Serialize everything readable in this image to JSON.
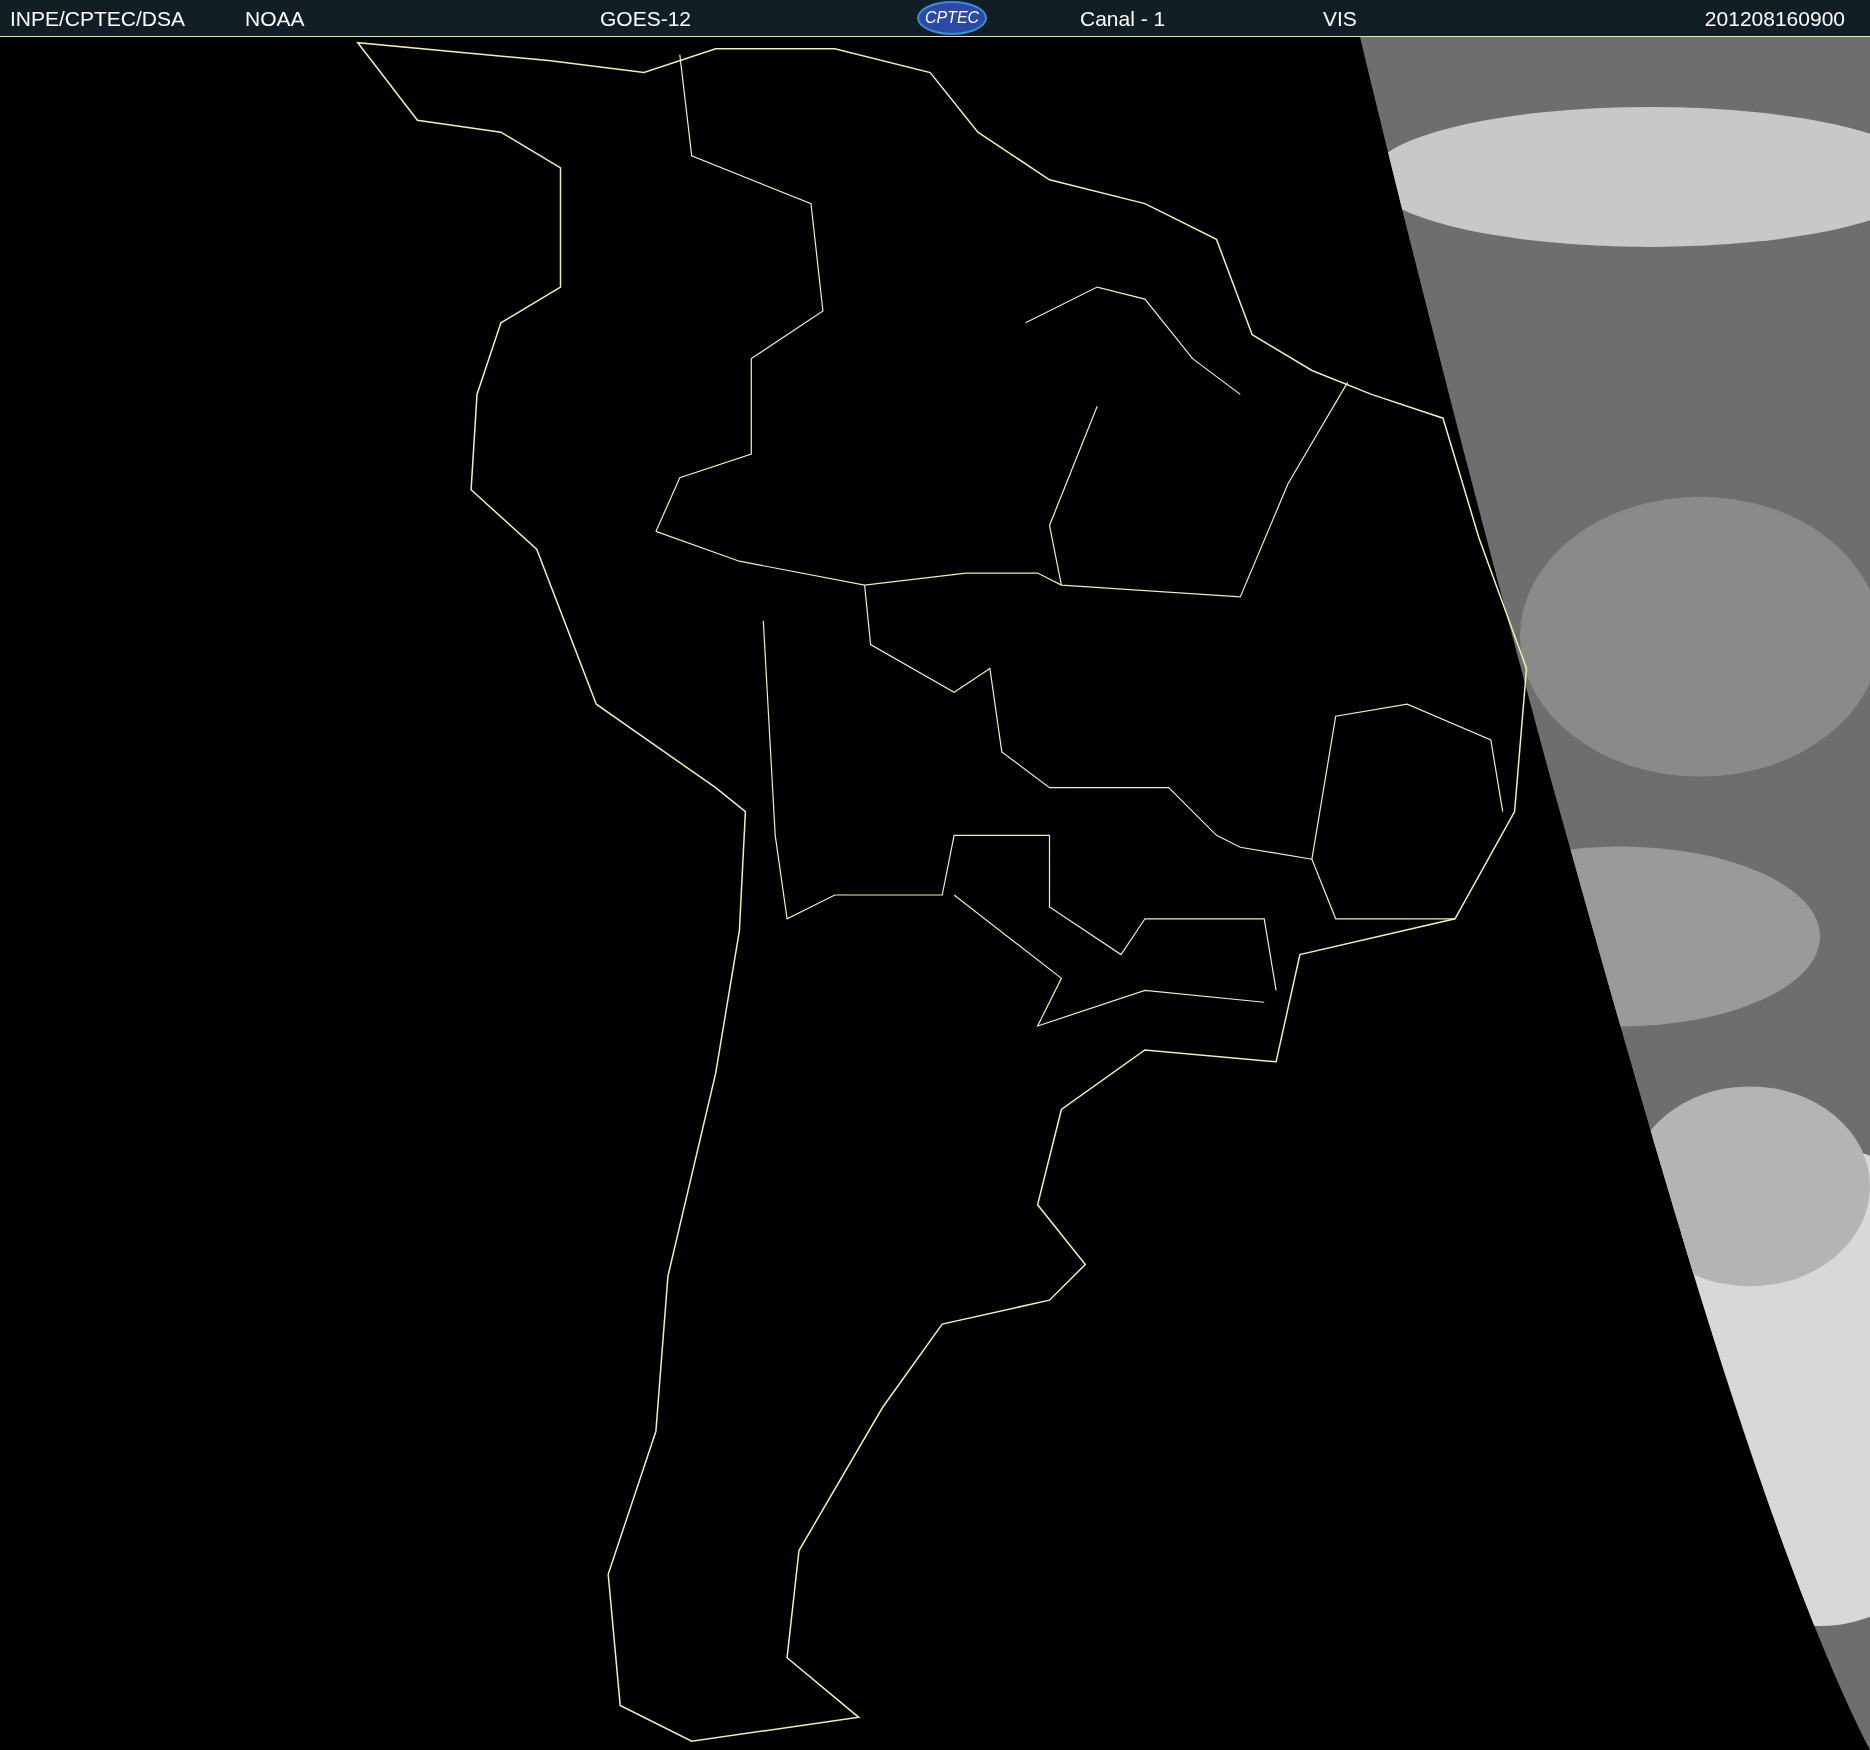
{
  "header": {
    "items": [
      {
        "kind": "text",
        "text": "INPE/CPTEC/DSA"
      },
      {
        "kind": "text",
        "text": "NOAA"
      },
      {
        "kind": "text",
        "text": "GOES-12"
      },
      {
        "kind": "logo",
        "text": "CPTEC"
      },
      {
        "kind": "text",
        "text": "Canal - 1"
      },
      {
        "kind": "text",
        "text": "VIS"
      },
      {
        "kind": "text",
        "text": "201208160900"
      }
    ]
  }
}
